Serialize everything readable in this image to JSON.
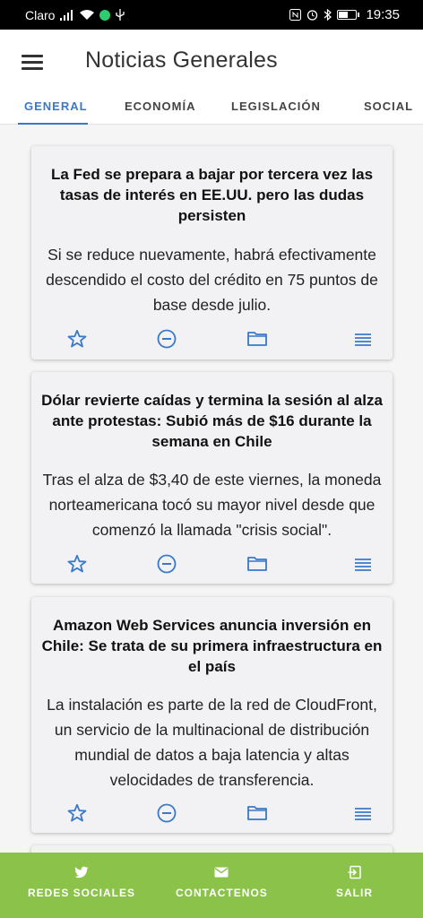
{
  "status_bar": {
    "carrier": "Claro",
    "time": "19:35",
    "icons": [
      "signal-icon",
      "wifi-icon",
      "app-badge-icon",
      "usb-icon",
      "nfc-icon",
      "alarm-icon",
      "bluetooth-icon",
      "battery-icon"
    ]
  },
  "app_bar": {
    "title": "Noticias Generales",
    "menu_icon": "hamburger-menu-icon"
  },
  "tabs": [
    {
      "label": "GENERAL",
      "active": true
    },
    {
      "label": "ECONOMÍA",
      "active": false
    },
    {
      "label": "LEGISLACIÓN",
      "active": false
    },
    {
      "label": "SOCIAL",
      "active": false
    }
  ],
  "articles": [
    {
      "title": "La Fed se prepara a bajar por tercera vez las tasas de interés en EE.UU. pero las dudas persisten",
      "summary": "Si se reduce nuevamente, habrá efectivamente descendido el costo del crédito en 75 puntos de base desde julio."
    },
    {
      "title": "Dólar revierte caídas y termina la sesión al alza ante protestas: Subió más de $16 durante la semana en Chile",
      "summary": "Tras el alza de $3,40 de este viernes, la moneda norteamericana tocó su mayor nivel desde que comenzó la llamada \"crisis social\"."
    },
    {
      "title": "Amazon Web Services anuncia inversión en Chile: Se trata de su primera infraestructura en el país",
      "summary": "La instalación es parte de la red de CloudFront, un servicio de la multinacional de distribución mundial de datos a baja latencia y altas velocidades de transferencia."
    }
  ],
  "card_actions": [
    "star-icon",
    "remove-circle-icon",
    "folder-icon",
    "list-icon"
  ],
  "bottom_bar": [
    {
      "label": "REDES SOCIALES",
      "icon": "twitter-icon"
    },
    {
      "label": "CONTACTENOS",
      "icon": "email-icon"
    },
    {
      "label": "SALIR",
      "icon": "exit-icon"
    }
  ],
  "colors": {
    "accent": "#3a78c8",
    "bottom_bar": "#8bc34a",
    "card_bg": "#f2f2f4"
  }
}
